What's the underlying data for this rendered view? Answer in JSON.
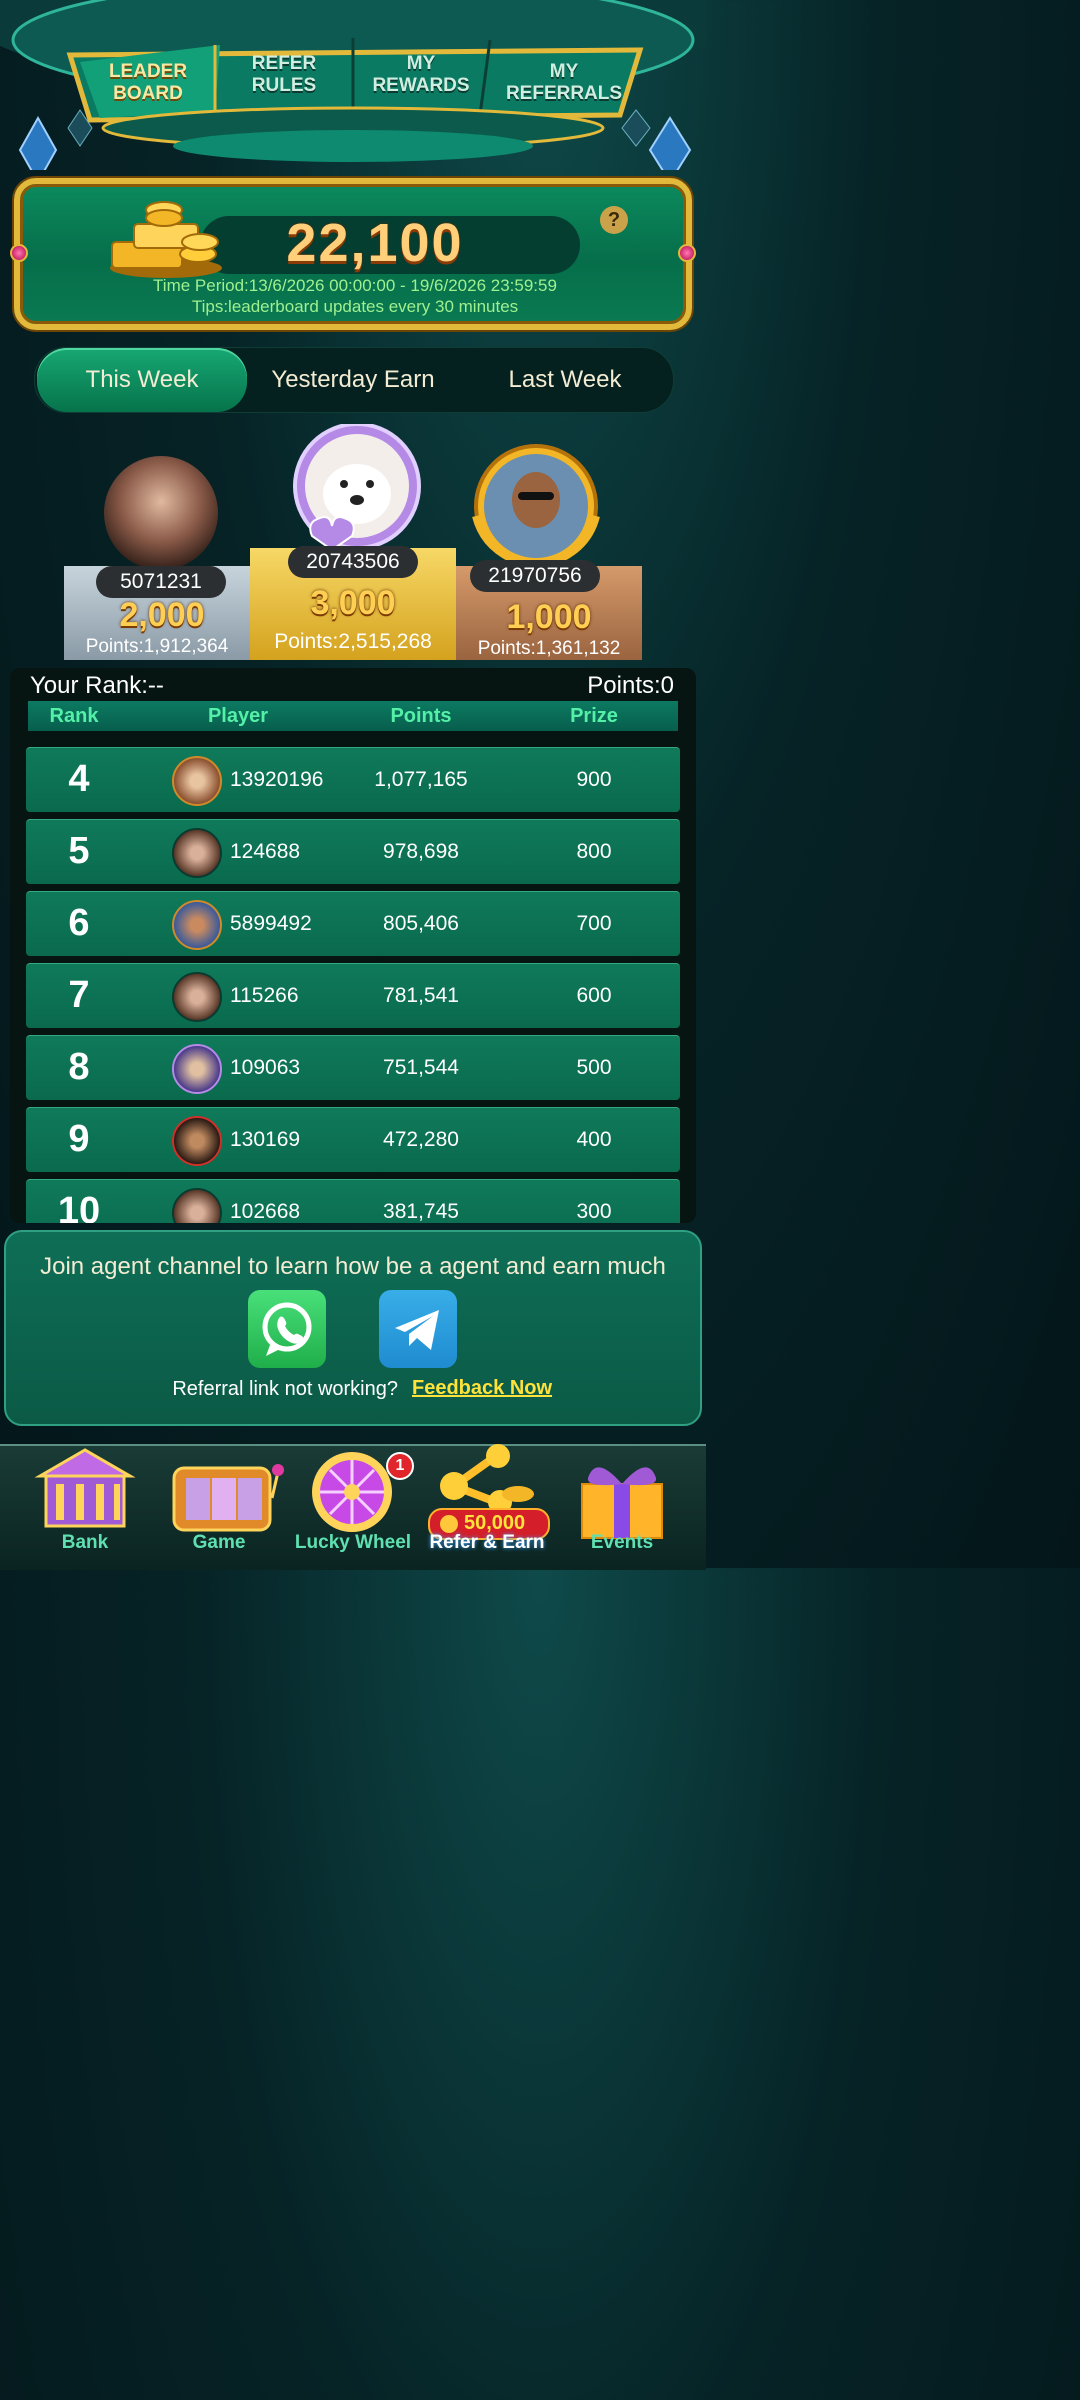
{
  "nav": {
    "tabs": [
      {
        "line1": "LEADER",
        "line2": "BOARD"
      },
      {
        "line1": "REFER",
        "line2": "RULES"
      },
      {
        "line1": "MY",
        "line2": "REWARDS"
      },
      {
        "line1": "MY",
        "line2": "REFERRALS"
      }
    ]
  },
  "banner": {
    "score": "22,100",
    "time_period": "Time Period:13/6/2026 00:00:00 - 19/6/2026 23:59:59",
    "tips": "Tips:leaderboard updates every 30 minutes",
    "help": "?"
  },
  "period_tabs": [
    "This Week",
    "Yesterday Earn",
    "Last Week"
  ],
  "podium": {
    "first": {
      "id": "20743506",
      "prize": "3,000",
      "points": "Points:2,515,268"
    },
    "second": {
      "id": "5071231",
      "prize": "2,000",
      "points": "Points:1,912,364"
    },
    "third": {
      "id": "21970756",
      "prize": "1,000",
      "points": "Points:1,361,132"
    }
  },
  "your_rank": {
    "label": "Your Rank:--",
    "points": "Points:0"
  },
  "table": {
    "headers": [
      "Rank",
      "Player",
      "Points",
      "Prize"
    ],
    "rows": [
      {
        "rank": "4",
        "player": "13920196",
        "points": "1,077,165",
        "prize": "900"
      },
      {
        "rank": "5",
        "player": "124688",
        "points": "978,698",
        "prize": "800"
      },
      {
        "rank": "6",
        "player": "5899492",
        "points": "805,406",
        "prize": "700"
      },
      {
        "rank": "7",
        "player": "115266",
        "points": "781,541",
        "prize": "600"
      },
      {
        "rank": "8",
        "player": "109063",
        "points": "751,544",
        "prize": "500"
      },
      {
        "rank": "9",
        "player": "130169",
        "points": "472,280",
        "prize": "400"
      },
      {
        "rank": "10",
        "player": "102668",
        "points": "381,745",
        "prize": "300"
      }
    ]
  },
  "join": {
    "text": "Join agent channel to learn how be a agent and earn much",
    "referral_q": "Referral link not working?",
    "feedback": "Feedback Now"
  },
  "bottom_nav": {
    "items": [
      "Bank",
      "Game",
      "Lucky Wheel",
      "Refer & Earn",
      "Events"
    ],
    "lucky_badge": "1",
    "refer_coins": "50,000"
  },
  "colors": {
    "accent": "#0a7a52",
    "gold": "#e2b93a",
    "highlight": "#ffd23a"
  }
}
